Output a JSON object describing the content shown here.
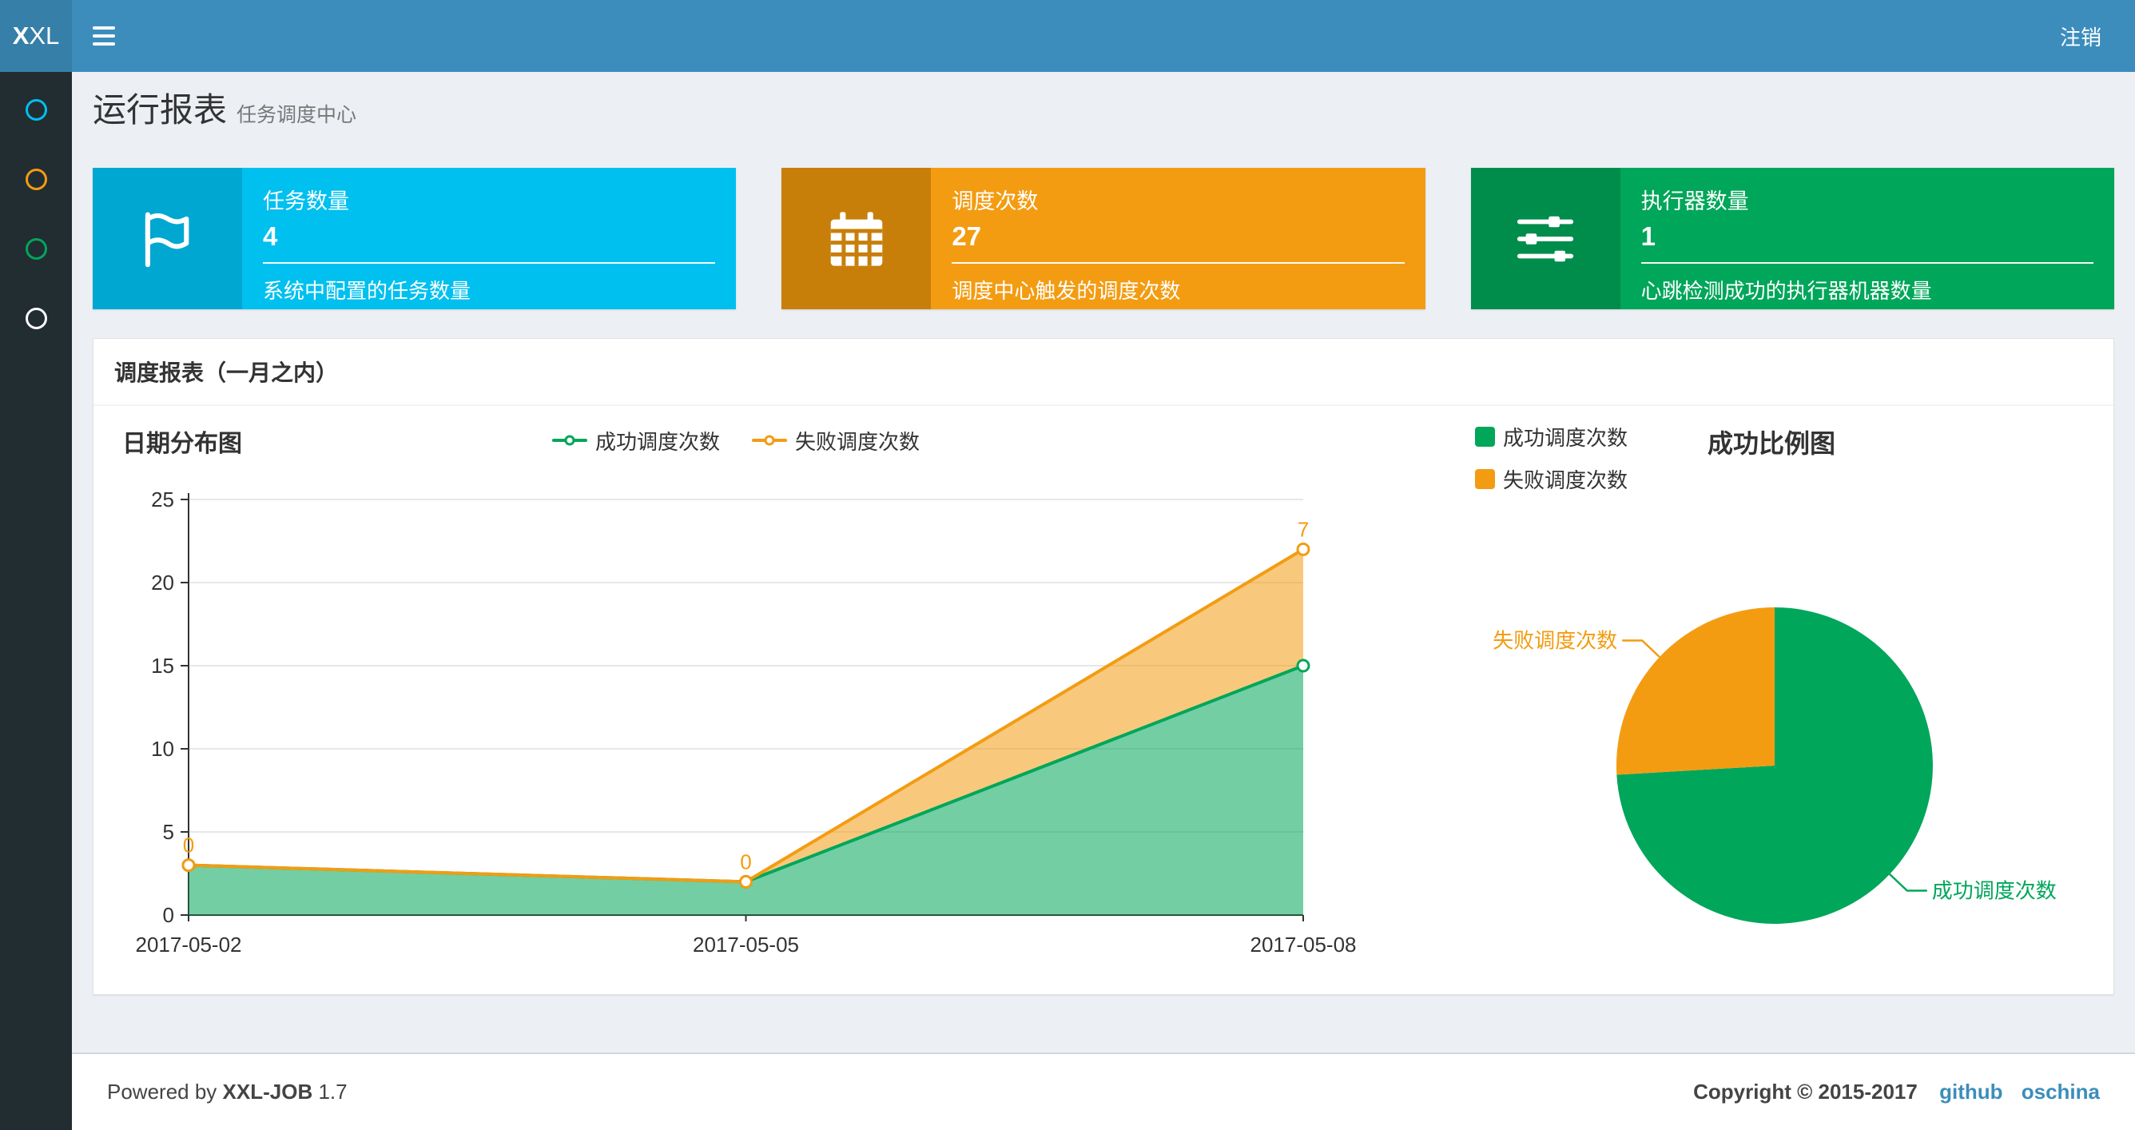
{
  "theme": {
    "navbar_bg": "#3c8dbc",
    "logo_bg": "#367fa9",
    "sidebar_bg": "#222d32",
    "content_bg": "#ecf0f5",
    "link_color": "#3c8dbc"
  },
  "navbar": {
    "logo_bold": "X",
    "logo_rest": "XL",
    "logout_label": "注销"
  },
  "sidebar": {
    "items": [
      {
        "icon": "circle-o",
        "color": "#00c0ef"
      },
      {
        "icon": "circle-o",
        "color": "#f39c12"
      },
      {
        "icon": "circle-o",
        "color": "#00a65a"
      },
      {
        "icon": "circle-o",
        "color": "#ffffff"
      }
    ]
  },
  "header": {
    "title": "运行报表",
    "subtitle": "任务调度中心"
  },
  "info_boxes": [
    {
      "icon": "flag",
      "title": "任务数量",
      "value": "4",
      "desc": "系统中配置的任务数量",
      "color": "#00c0ef",
      "icon_bg": "#00a7d0"
    },
    {
      "icon": "calendar",
      "title": "调度次数",
      "value": "27",
      "desc": "调度中心触发的调度次数",
      "color": "#f39c12",
      "icon_bg": "#c87f0a"
    },
    {
      "icon": "sliders",
      "title": "执行器数量",
      "value": "1",
      "desc": "心跳检测成功的执行器机器数量",
      "color": "#00a65a",
      "icon_bg": "#008d4c"
    }
  ],
  "panel": {
    "title": "调度报表（一月之内）"
  },
  "chart_data": [
    {
      "type": "area",
      "title": "日期分布图",
      "x": [
        "2017-05-02",
        "2017-05-05",
        "2017-05-08"
      ],
      "series": [
        {
          "name": "成功调度次数",
          "values": [
            3,
            2,
            15
          ],
          "color": "#00a65a"
        },
        {
          "name": "失败调度次数",
          "values": [
            0,
            0,
            7
          ],
          "color": "#f39c12"
        }
      ],
      "stacked": true,
      "value_labels_series": "失败调度次数",
      "ylim": [
        0,
        25
      ],
      "yticks": [
        0,
        5,
        10,
        15,
        20,
        25
      ],
      "grid": true,
      "legend_position": "top-center"
    },
    {
      "type": "pie",
      "title": "成功比例图",
      "slices": [
        {
          "name": "成功调度次数",
          "value": 20,
          "color": "#00a65a"
        },
        {
          "name": "失败调度次数",
          "value": 7,
          "color": "#f39c12"
        }
      ],
      "legend_position": "top-left"
    }
  ],
  "footer": {
    "powered_prefix": "Powered by",
    "product": "XXL-JOB",
    "version": "1.7",
    "copyright": "Copyright © 2015-2017",
    "links": [
      "github",
      "oschina"
    ]
  }
}
